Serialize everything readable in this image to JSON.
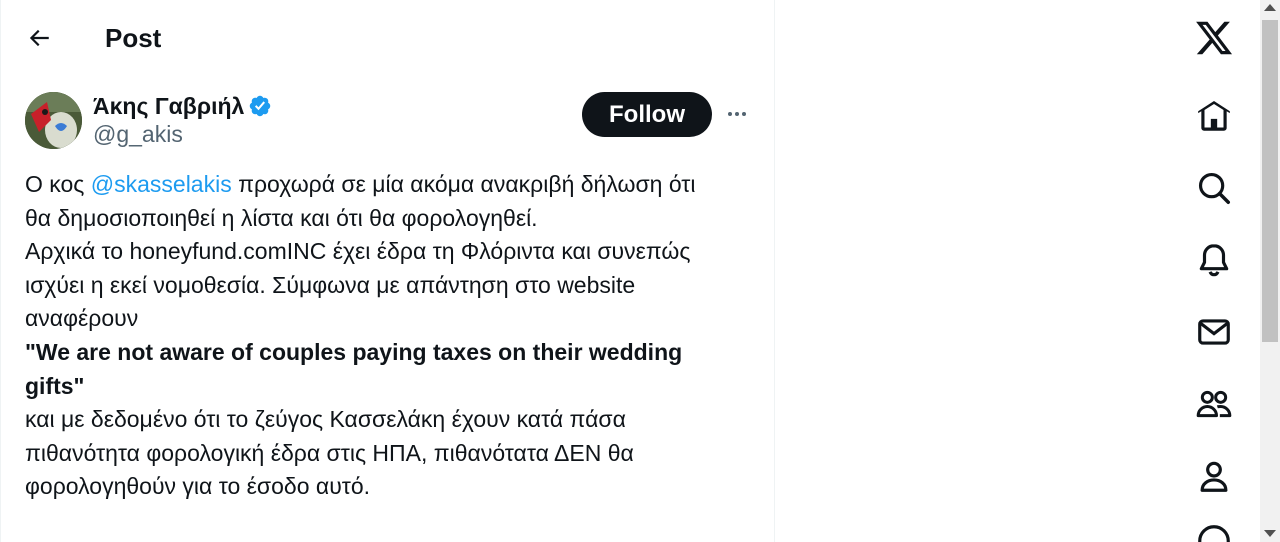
{
  "header": {
    "back_icon": "arrow-left-icon",
    "title": "Post"
  },
  "post": {
    "author": {
      "display_name": "Άκης Γαβριήλ",
      "verified_icon": "verified-badge-icon",
      "handle": "@g_akis"
    },
    "follow_label": "Follow",
    "more_icon": "more-horizontal-icon",
    "text": {
      "l1_pre": "Ο κος ",
      "l1_mention": "@skasselakis",
      "l1_post": " προχωρά σε μία ακόμα ανακριβή δήλωση ότι",
      "l2": "θα δημοσιοποιηθεί η λίστα και ότι θα φορολογηθεί.",
      "l3": "Αρχικά το honeyfund.comINC έχει έδρα τη Φλόριντα και συνεπώς",
      "l4": "ισχύει η εκεί νομοθεσία. Σύμφωνα με απάντηση στο website",
      "l5": "αναφέρουν",
      "l6": "\"We are not aware of couples paying taxes on their wedding",
      "l7": "gifts\"",
      "l8": "και με δεδομένο ότι το ζεύγος Κασσελάκη έχουν κατά πάσα",
      "l9": "πιθανότητα φορολογική έδρα στις ΗΠΑ, πιθανότατα ΔΕΝ θα",
      "l10": "φορολογηθούν για το έσοδο αυτό."
    }
  },
  "right_rail": {
    "items": [
      "x-logo-icon",
      "home-icon",
      "search-icon",
      "notifications-bell-icon",
      "messages-envelope-icon",
      "communities-icon",
      "profile-icon",
      "more-circle-icon"
    ]
  },
  "colors": {
    "accent": "#1d9bf0",
    "text": "#0f1419",
    "muted": "#536471"
  }
}
